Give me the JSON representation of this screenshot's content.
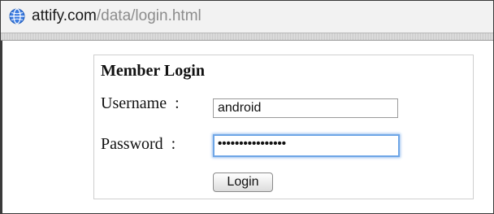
{
  "browser": {
    "url_domain": "attify.com",
    "url_path": "/data/login.html",
    "icon": "globe-icon"
  },
  "login": {
    "title": "Member Login",
    "username_label": "Username  :",
    "username_value": "android",
    "password_label": "Password  :",
    "password_masked": "••••••••••••••••",
    "submit_label": "Login"
  },
  "colors": {
    "focus_ring": "#6fa6e6",
    "url_path": "#8c8c8c"
  }
}
